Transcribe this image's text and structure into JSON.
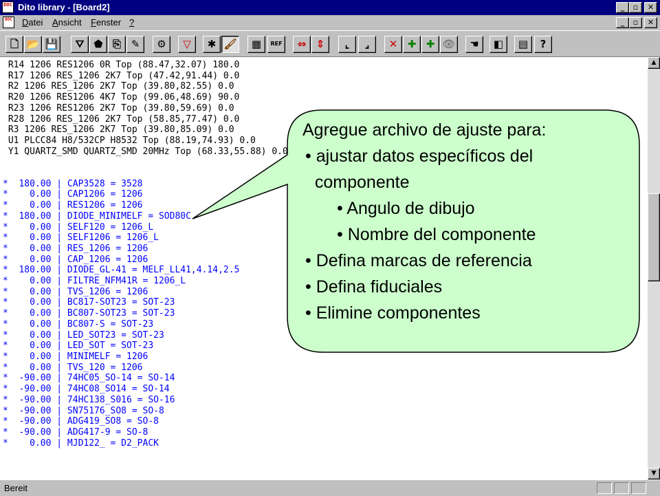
{
  "window": {
    "title": "Dito library - [Board2]",
    "app_icon_text": "DOC",
    "title_buttons": [
      "_",
      "▫",
      "✕"
    ]
  },
  "menu": {
    "doc_icon_text": "DOC",
    "items": [
      {
        "prefix": "",
        "accel": "D",
        "rest": "atei"
      },
      {
        "prefix": "",
        "accel": "A",
        "rest": "nsicht"
      },
      {
        "prefix": "",
        "accel": "F",
        "rest": "enster"
      },
      {
        "prefix": "",
        "accel": "?",
        "rest": ""
      }
    ],
    "mdi_buttons": [
      "_",
      "▫",
      "✕"
    ]
  },
  "toolbar": {
    "icons": [
      {
        "name": "new-file-icon",
        "glyph": "🗋"
      },
      {
        "name": "open-folder-icon",
        "glyph": "📂"
      },
      {
        "name": "save-icon",
        "glyph": "💾"
      },
      {
        "name": "component-funnel-icon",
        "glyph": "⛛"
      },
      {
        "name": "component-shape-icon",
        "glyph": "⬟"
      },
      {
        "name": "component-copy-icon",
        "glyph": "⎘"
      },
      {
        "name": "component-edit-icon",
        "glyph": "✎"
      },
      {
        "name": "settings-gear-icon",
        "glyph": "⚙"
      },
      {
        "name": "filter-funnel-icon",
        "glyph": "▽"
      },
      {
        "name": "wizard-icon",
        "glyph": "✱"
      },
      {
        "name": "brush-icon",
        "glyph": "🖌"
      },
      {
        "name": "grid-list-icon",
        "glyph": "▦"
      },
      {
        "name": "ref-icon",
        "glyph": "REF"
      },
      {
        "name": "horizontal-arrows-icon",
        "glyph": "⇔"
      },
      {
        "name": "vertical-arrows-icon",
        "glyph": "⇕"
      },
      {
        "name": "align-x-icon",
        "glyph": "⌞"
      },
      {
        "name": "align-y-icon",
        "glyph": "⌟"
      },
      {
        "name": "delete-x-icon",
        "glyph": "✕"
      },
      {
        "name": "add-r1-icon",
        "glyph": "✚"
      },
      {
        "name": "add-r2-icon",
        "glyph": "✚"
      },
      {
        "name": "eye-icon",
        "glyph": "👁"
      },
      {
        "name": "hand-icon",
        "glyph": "☚"
      },
      {
        "name": "eraser-icon",
        "glyph": "◧"
      },
      {
        "name": "document-icon",
        "glyph": "▤"
      },
      {
        "name": "help-icon",
        "glyph": "?"
      }
    ]
  },
  "document": {
    "lines": [
      {
        "c": "blk",
        "t": " R14 1206 RES1206 0R Top (88.47,32.07) 180.0"
      },
      {
        "c": "blk",
        "t": " R17 1206 RES_1206 2K7 Top (47.42,91.44) 0.0"
      },
      {
        "c": "blk",
        "t": " R2 1206 RES_1206 2K7 Top (39.80,82.55) 0.0"
      },
      {
        "c": "blk",
        "t": " R20 1206 RES1206 4K7 Top (99.06,48.69) 90.0"
      },
      {
        "c": "blk",
        "t": " R23 1206 RES1206 2K7 Top (39.80,59.69) 0.0"
      },
      {
        "c": "blk",
        "t": " R28 1206 RES_1206 2K7 Top (58.85,77.47) 0.0"
      },
      {
        "c": "blk",
        "t": " R3 1206 RES_1206 2K7 Top (39.80,85.09) 0.0"
      },
      {
        "c": "blk",
        "t": " U1 PLCC84 H8/532CP H8532 Top (88.19,74.93) 0.0"
      },
      {
        "c": "blk",
        "t": " Y1 QUARTZ_SMD QUARTZ_SMD 20MHz Top (68.33,55.88) 0.0"
      },
      {
        "c": "blk",
        "t": ""
      },
      {
        "c": "blk",
        "t": ""
      },
      {
        "c": "blu",
        "t": "*  180.00 | CAP3528 = 3528"
      },
      {
        "c": "blu",
        "t": "*    0.00 | CAP1206 = 1206"
      },
      {
        "c": "blu",
        "t": "*    0.00 | RES1206 = 1206"
      },
      {
        "c": "blu",
        "t": "*  180.00 | DIODE_MINIMELF = SOD80C"
      },
      {
        "c": "blu",
        "t": "*    0.00 | SELF120 = 1206_L"
      },
      {
        "c": "blu",
        "t": "*    0.00 | SELF1206 = 1206_L"
      },
      {
        "c": "blu",
        "t": "*    0.00 | RES_1206 = 1206"
      },
      {
        "c": "blu",
        "t": "*    0.00 | CAP_1206 = 1206"
      },
      {
        "c": "blu",
        "t": "*  180.00 | DIODE_GL-41 = MELF_LL41,4.14,2.5"
      },
      {
        "c": "blu",
        "t": "*    0.00 | FILTRE_NFM41R = 1206_L"
      },
      {
        "c": "blu",
        "t": "*    0.00 | TVS_1206 = 1206"
      },
      {
        "c": "blu",
        "t": "*    0.00 | BC817-SOT23 = SOT-23"
      },
      {
        "c": "blu",
        "t": "*    0.00 | BC807-SOT23 = SOT-23"
      },
      {
        "c": "blu",
        "t": "*    0.00 | BC807-S = SOT-23"
      },
      {
        "c": "blu",
        "t": "*    0.00 | LED_SOT23 = SOT-23"
      },
      {
        "c": "blu",
        "t": "*    0.00 | LED_SOT = SOT-23"
      },
      {
        "c": "blu",
        "t": "*    0.00 | MINIMELF = 1206"
      },
      {
        "c": "blu",
        "t": "*    0.00 | TVS_120 = 1206"
      },
      {
        "c": "blu",
        "t": "*  -90.00 | 74HC05_SO-14 = SO-14"
      },
      {
        "c": "blu",
        "t": "*  -90.00 | 74HC08_SO14 = SO-14"
      },
      {
        "c": "blu",
        "t": "*  -90.00 | 74HC138_S016 = SO-16"
      },
      {
        "c": "blu",
        "t": "*  -90.00 | SN75176_SO8 = SO-8"
      },
      {
        "c": "blu",
        "t": "*  -90.00 | ADG419_SO8 = SO-8"
      },
      {
        "c": "blu",
        "t": "*  -90.00 | ADG417-9 = SO-8"
      },
      {
        "c": "blu",
        "t": "*    0.00 | MJD122_ = D2_PACK"
      }
    ]
  },
  "scrollbar": {
    "up": "▲",
    "down": "▼"
  },
  "callout": {
    "heading": "Agregue archivo de ajuste para:",
    "items": [
      {
        "text": "• ajustar datos específicos del",
        "indent": 0
      },
      {
        "text": "  componente",
        "indent": 0
      },
      {
        "text": "• Angulo de dibujo",
        "indent": 1
      },
      {
        "text": "• Nombre del componente",
        "indent": 1
      },
      {
        "text": "• Defina marcas de referencia",
        "indent": 0
      },
      {
        "text": "• Defina fiduciales",
        "indent": 0
      },
      {
        "text": "• Elimine componentes",
        "indent": 0
      }
    ],
    "fill": "#ccffcc"
  },
  "status": {
    "text": "Bereit"
  }
}
